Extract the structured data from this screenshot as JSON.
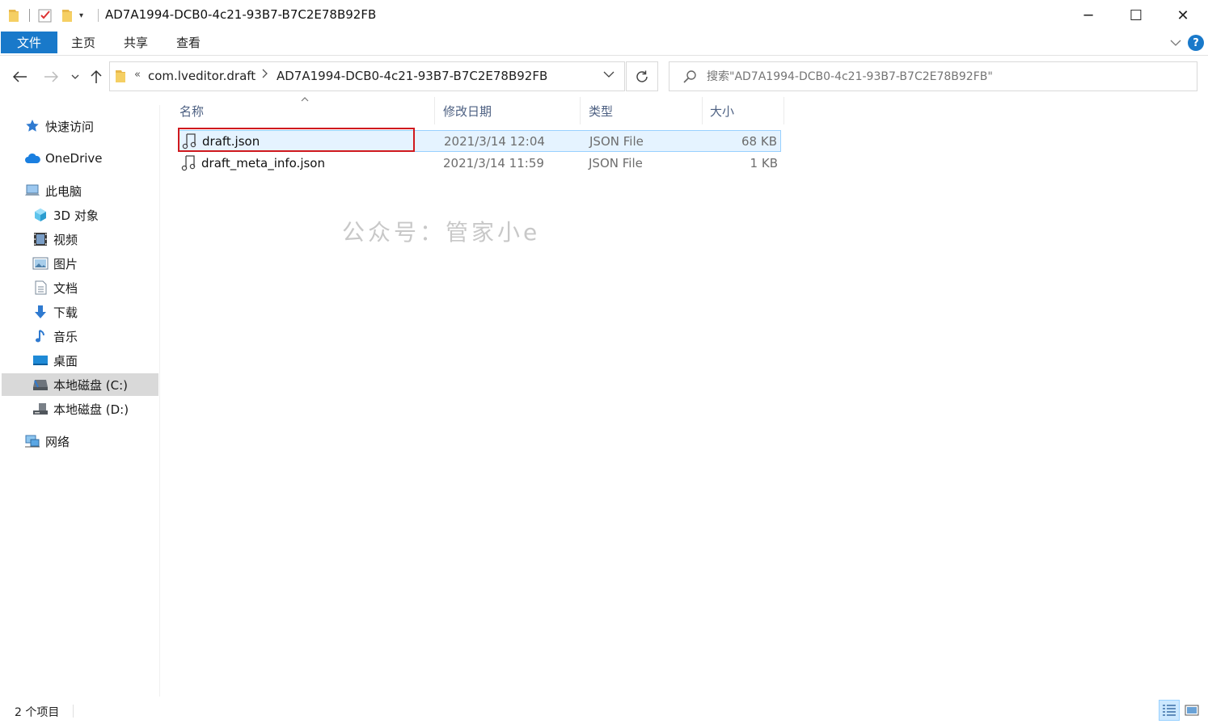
{
  "window": {
    "title": "AD7A1994-DCB0-4c21-93B7-B7C2E78B92FB",
    "minimize_glyph": "─",
    "maximize_glyph": "☐",
    "close_glyph": "✕"
  },
  "ribbon": {
    "tabs": [
      {
        "label": "文件"
      },
      {
        "label": "主页"
      },
      {
        "label": "共享"
      },
      {
        "label": "查看"
      }
    ],
    "help_glyph": "?"
  },
  "address": {
    "overflow_glyph": "«",
    "crumbs": [
      {
        "label": "com.lveditor.draft"
      },
      {
        "label": "AD7A1994-DCB0-4c21-93B7-B7C2E78B92FB"
      }
    ]
  },
  "search": {
    "placeholder": "搜索\"AD7A1994-DCB0-4c21-93B7-B7C2E78B92FB\""
  },
  "navpane": {
    "items": [
      {
        "label": "快速访问",
        "icon": "star-icon"
      },
      {
        "label": "OneDrive",
        "icon": "cloud-icon"
      },
      {
        "label": "此电脑",
        "icon": "computer-icon"
      },
      {
        "label": "3D 对象",
        "icon": "cube-icon"
      },
      {
        "label": "视频",
        "icon": "film-icon"
      },
      {
        "label": "图片",
        "icon": "picture-icon"
      },
      {
        "label": "文档",
        "icon": "document-icon"
      },
      {
        "label": "下载",
        "icon": "download-arrow-icon"
      },
      {
        "label": "音乐",
        "icon": "music-note-icon"
      },
      {
        "label": "桌面",
        "icon": "desktop-icon"
      },
      {
        "label": "本地磁盘 (C:)",
        "icon": "drive-c-icon"
      },
      {
        "label": "本地磁盘 (D:)",
        "icon": "drive-d-icon"
      },
      {
        "label": "网络",
        "icon": "network-icon"
      }
    ]
  },
  "filelist": {
    "columns": {
      "name": "名称",
      "date": "修改日期",
      "type": "类型",
      "size": "大小"
    },
    "rows": [
      {
        "name": "draft.json",
        "date": "2021/3/14 12:04",
        "type": "JSON File",
        "size": "68 KB"
      },
      {
        "name": "draft_meta_info.json",
        "date": "2021/3/14 11:59",
        "type": "JSON File",
        "size": "1 KB"
      }
    ]
  },
  "watermark": "公众号：管家小e",
  "status": {
    "item_count": "2 个项目"
  },
  "colors": {
    "accent": "#1979ca",
    "selection": "#cce8ff",
    "highlight_box": "#d0191e"
  }
}
